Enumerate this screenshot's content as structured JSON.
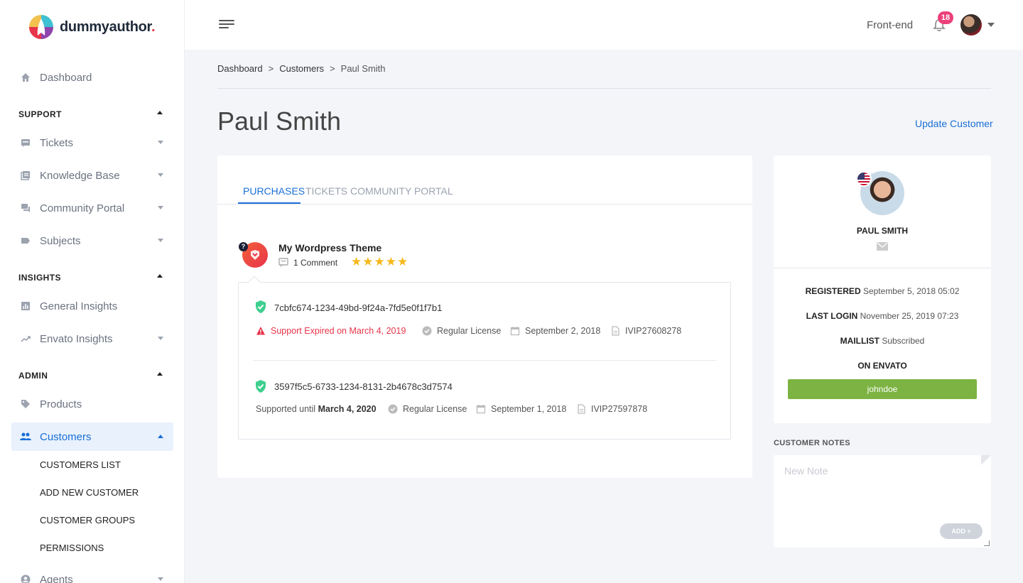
{
  "app": {
    "logo_text": "dummyauthor",
    "logo_dot": "."
  },
  "sidebar": {
    "dashboard": "Dashboard",
    "sections": {
      "support": "SUPPORT",
      "insights": "INSIGHTS",
      "admin": "ADMIN"
    },
    "items": [
      {
        "label": "Tickets",
        "icon": "ticket-icon"
      },
      {
        "label": "Knowledge Base",
        "icon": "book-icon"
      },
      {
        "label": "Community Portal",
        "icon": "forum-icon"
      },
      {
        "label": "Subjects",
        "icon": "label-icon"
      },
      {
        "label": "General Insights",
        "icon": "bar-chart-icon"
      },
      {
        "label": "Envato Insights",
        "icon": "trending-icon"
      },
      {
        "label": "Products",
        "icon": "tag-icon"
      },
      {
        "label": "Customers",
        "icon": "people-icon"
      },
      {
        "label": "Agents",
        "icon": "person-icon"
      }
    ],
    "customers_sub": [
      "CUSTOMERS LIST",
      "ADD NEW CUSTOMER",
      "CUSTOMER GROUPS",
      "PERMISSIONS"
    ]
  },
  "topbar": {
    "frontend": "Front-end",
    "notification_count": "18"
  },
  "breadcrumb": {
    "items": [
      "Dashboard",
      "Customers",
      "Paul Smith"
    ],
    "separator": ">"
  },
  "page": {
    "title": "Paul Smith",
    "update_link": "Update Customer"
  },
  "tabs": [
    "PURCHASES",
    "TICKETS",
    "COMMUNITY PORTAL"
  ],
  "product": {
    "name": "My Wordpress Theme",
    "comments": "1 Comment",
    "rating": 5,
    "stars": "★★★★★",
    "badge": "?"
  },
  "purchases": [
    {
      "code": "7cbfc674-1234-49bd-9f24a-7fd5e0f1f7b1",
      "support": "Support Expired on March 4, 2019",
      "license": "Regular License",
      "date": "September 2, 2018",
      "invoice": "IVIP27608278"
    },
    {
      "code": "3597f5c5-6733-1234-8131-2b4678c3d7574",
      "support_prefix": "Supported until ",
      "support_date": "March 4, 2020",
      "license": "Regular License",
      "date": "September 1, 2018",
      "invoice": "IVIP27597878"
    }
  ],
  "customer": {
    "name": "PAUL SMITH",
    "registered_label": "REGISTERED",
    "registered": "September 5, 2018 05:02",
    "last_login_label": "LAST LOGIN",
    "last_login": "November 25, 2019 07:23",
    "maillist_label": "MAILLIST",
    "maillist": "Subscribed",
    "envato_label": "ON ENVATO",
    "envato_user": "johndoe"
  },
  "notes": {
    "title": "CUSTOMER NOTES",
    "placeholder": "New Note",
    "add_label": "ADD +"
  },
  "colors": {
    "accent": "#1a6fd6",
    "danger": "#e8354b",
    "success": "#7cb342",
    "badge": "#ec407a",
    "star": "#f6b81b",
    "shield": "#3ecf8e"
  }
}
